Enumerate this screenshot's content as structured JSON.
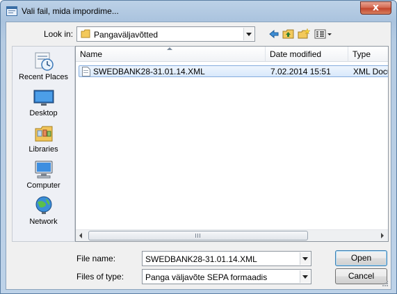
{
  "window": {
    "title": "Vali fail, mida impordime...",
    "close_symbol": "x"
  },
  "toolbar": {
    "look_in_label": "Look in:",
    "look_in_value": "Pangaväljavõtted",
    "icons": [
      "back-arrow-icon",
      "up-folder-icon",
      "new-folder-icon",
      "view-menu-icon"
    ]
  },
  "places": [
    {
      "label": "Recent Places",
      "icon": "recent-places-icon"
    },
    {
      "label": "Desktop",
      "icon": "desktop-icon"
    },
    {
      "label": "Libraries",
      "icon": "libraries-icon"
    },
    {
      "label": "Computer",
      "icon": "computer-icon"
    },
    {
      "label": "Network",
      "icon": "network-icon"
    }
  ],
  "file_list": {
    "columns": [
      "Name",
      "Date modified",
      "Type"
    ],
    "rows": [
      {
        "name": "SWEDBANK28-31.01.14.XML",
        "date_modified": "7.02.2014 15:51",
        "type": "XML Docu"
      }
    ],
    "scroll_grip": "III"
  },
  "footer": {
    "file_name_label": "File name:",
    "file_name_value": "SWEDBANK28-31.01.14.XML",
    "files_of_type_label": "Files of type:",
    "files_of_type_value": "Panga väljavõte SEPA formaadis",
    "open_button": "Open",
    "cancel_button": "Cancel"
  },
  "colors": {
    "title_gradient": "#aac3de",
    "selection": "#d8e8fb",
    "close_red": "#c1422a"
  }
}
